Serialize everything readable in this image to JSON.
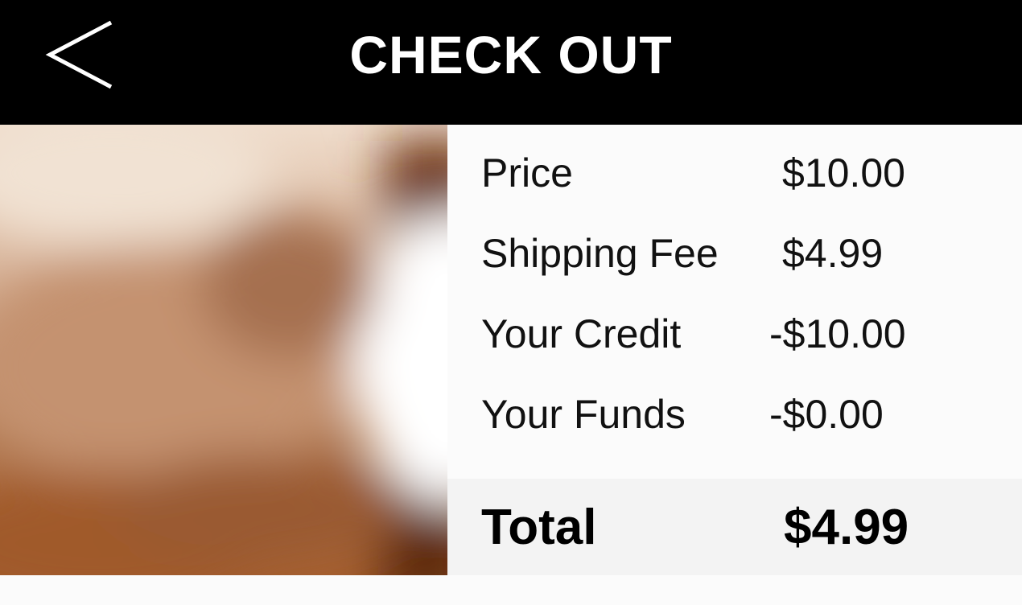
{
  "header": {
    "title": "CHECK OUT",
    "back_icon": "chevron-left-icon"
  },
  "product": {
    "image_icon": "product-image"
  },
  "summary": {
    "rows": [
      {
        "label": "Price",
        "value": "$10.00"
      },
      {
        "label": "Shipping Fee",
        "value": "$4.99"
      },
      {
        "label": "Your Credit",
        "value": "-$10.00"
      },
      {
        "label": "Your Funds",
        "value": "-$0.00"
      }
    ],
    "total": {
      "label": "Total",
      "value": "$4.99"
    }
  },
  "colors": {
    "header_bg": "#000000",
    "header_text": "#ffffff",
    "page_bg": "#fbfbfb",
    "total_bg": "#f3f3f3"
  }
}
